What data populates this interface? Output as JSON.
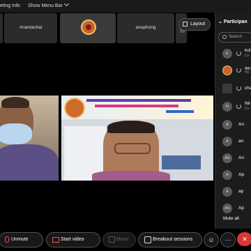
{
  "menu": {
    "meeting_info": "eting Info",
    "show_menu_bar": "Show Menu Bar"
  },
  "filmstrip": {
    "thumbs": [
      {
        "name": ""
      },
      {
        "name": "Anantachai"
      },
      {
        "name": ""
      },
      {
        "name": "anuphong"
      }
    ]
  },
  "layout_button": {
    "label": "Layout"
  },
  "participants": {
    "title": "Participan",
    "search_placeholder": "Search",
    "rows": [
      {
        "initial": "K",
        "name": "kol",
        "role": "Co"
      },
      {
        "initial": "",
        "name": "สถ",
        "role": "Ho"
      },
      {
        "initial": "",
        "name": "cha",
        "role": ""
      },
      {
        "initial": "N",
        "name": "Nir",
        "role": "Co"
      },
      {
        "initial": "A",
        "name": "An",
        "role": ""
      },
      {
        "initial": "A",
        "name": "an",
        "role": ""
      },
      {
        "initial": "AS",
        "name": "An",
        "role": ""
      },
      {
        "initial": "A",
        "name": "Ap",
        "role": ""
      },
      {
        "initial": "A",
        "name": "ap",
        "role": ""
      },
      {
        "initial": "AS",
        "name": "Ap",
        "role": ""
      }
    ],
    "mute_all": "Mute all"
  },
  "controls": {
    "unmute": "Unmute",
    "start_video": "Start video",
    "share": "Share",
    "breakout_sessions": "Breakout sessions",
    "reactions_glyph": "☺",
    "more_glyph": "⋯",
    "leave_glyph": "✕"
  }
}
